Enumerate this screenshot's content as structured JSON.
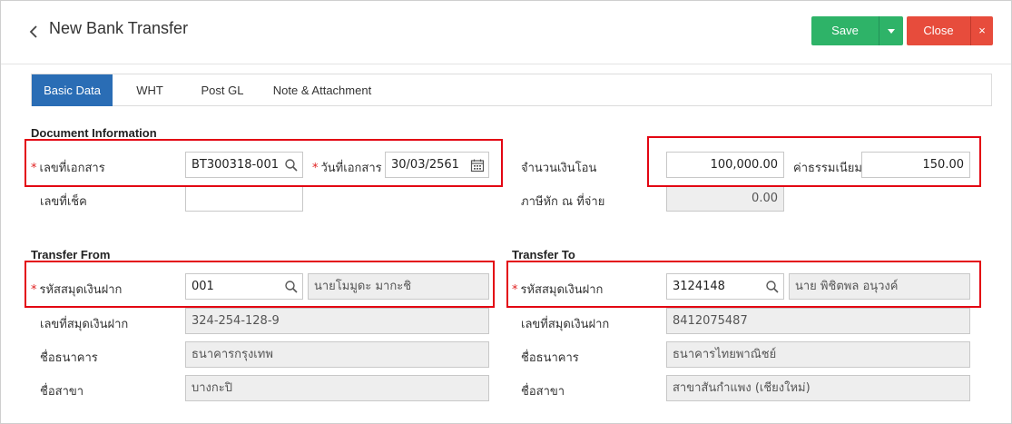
{
  "header": {
    "back_icon": "chevron-left-icon",
    "title": "New Bank Transfer",
    "save_label": "Save",
    "close_label": "Close",
    "close_x": "×",
    "colors": {
      "save": "#2eb368",
      "close": "#e74c3c",
      "tab_active": "#2a6db5",
      "highlight": "#e30613"
    }
  },
  "tabs": [
    {
      "label": "Basic Data",
      "active": true
    },
    {
      "label": "WHT",
      "active": false
    },
    {
      "label": "Post GL",
      "active": false
    },
    {
      "label": "Note & Attachment",
      "active": false
    }
  ],
  "document_info": {
    "title": "Document Information",
    "required_mark": "*",
    "doc_no_label": "เลขที่เอกสาร",
    "doc_no_value": "BT300318-001",
    "doc_date_label": "วันที่เอกสาร",
    "doc_date_value": "30/03/2561",
    "cheque_no_label": "เลขที่เช็ค",
    "cheque_no_value": "",
    "transfer_amount_label": "จำนวนเงินโอน",
    "transfer_amount_value": "100,000.00",
    "fee_label": "ค่าธรรมเนียม",
    "fee_value": "150.00",
    "wht_label": "ภาษีหัก ณ ที่จ่าย",
    "wht_value": "0.00"
  },
  "transfer_from": {
    "title": "Transfer From",
    "account_code_label": "รหัสสมุดเงินฝาก",
    "account_code_value": "001",
    "account_name_value": "นายโมมูดะ มากะชิ",
    "account_no_label": "เลขที่สมุดเงินฝาก",
    "account_no_value": "324-254-128-9",
    "bank_label": "ชื่อธนาคาร",
    "bank_value": "ธนาคารกรุงเทพ",
    "branch_label": "ชื่อสาขา",
    "branch_value": "บางกะปิ"
  },
  "transfer_to": {
    "title": "Transfer To",
    "account_code_label": "รหัสสมุดเงินฝาก",
    "account_code_value": "3124148",
    "account_name_value": "นาย พิชิตพล อนุวงค์",
    "account_no_label": "เลขที่สมุดเงินฝาก",
    "account_no_value": "8412075487",
    "bank_label": "ชื่อธนาคาร",
    "bank_value": "ธนาคารไทยพาณิชย์",
    "branch_label": "ชื่อสาขา",
    "branch_value": "สาขาสันกำแพง (เชียงใหม่)"
  }
}
